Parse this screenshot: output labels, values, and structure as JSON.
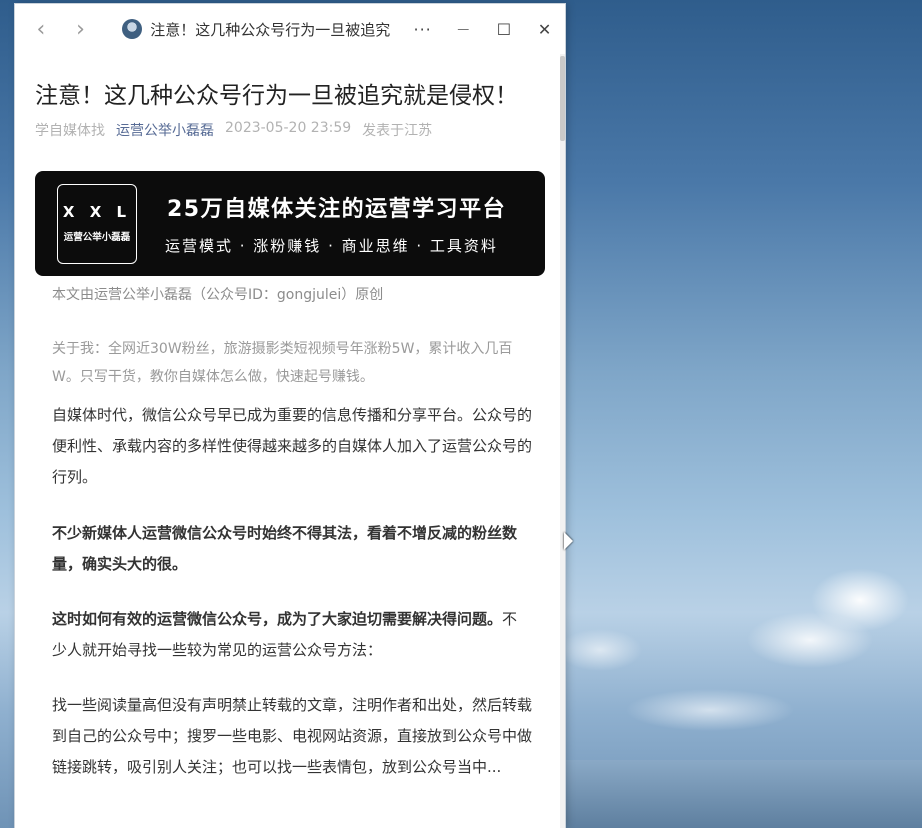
{
  "window": {
    "tab_title": "注意！这几种公众号行为一旦被追究",
    "controls": {
      "more": "···",
      "minimize": "—",
      "maximize": "☐",
      "close": "✕"
    },
    "nav": {
      "back": "‹",
      "forward": "›"
    }
  },
  "article": {
    "title": "注意！这几种公众号行为一旦被追究就是侵权！",
    "meta": {
      "source": "学自媒体找",
      "account": "运营公举小磊磊",
      "datetime": "2023-05-20 23:59",
      "location": "发表于江苏"
    },
    "banner": {
      "logo_mark": "X X L",
      "logo_text": "运营公举小磊磊",
      "headline": "25万自媒体关注的运营学习平台",
      "subline": "运营模式 · 涨粉赚钱 · 商业思维 · 工具资料"
    },
    "source_note": "本文由运营公举小磊磊（公众号ID：gongjulei）原创",
    "about": "关于我：全网近30W粉丝，旅游摄影类短视频号年涨粉5W，累计收入几百W。只写干货，教你自媒体怎么做，快速起号赚钱。",
    "paragraphs": {
      "p1": "自媒体时代，微信公众号早已成为重要的信息传播和分享平台。公众号的便利性、承载内容的多样性使得越来越多的自媒体人加入了运营公众号的行列。",
      "p2": "不少新媒体人运营微信公众号时始终不得其法，看着不增反减的粉丝数量，确实头大的很。",
      "p3_bold": "这时如何有效的运营微信公众号，成为了大家迫切需要解决得问题。",
      "p3_rest": "不少人就开始寻找一些较为常见的运营公众号方法：",
      "p4": "找一些阅读量高但没有声明禁止转载的文章，注明作者和出处，然后转载到自己的公众号中；搜罗一些电影、电视网站资源，直接放到公众号中做链接跳转，吸引别人关注；也可以找一些表情包，放到公众号当中..."
    }
  }
}
